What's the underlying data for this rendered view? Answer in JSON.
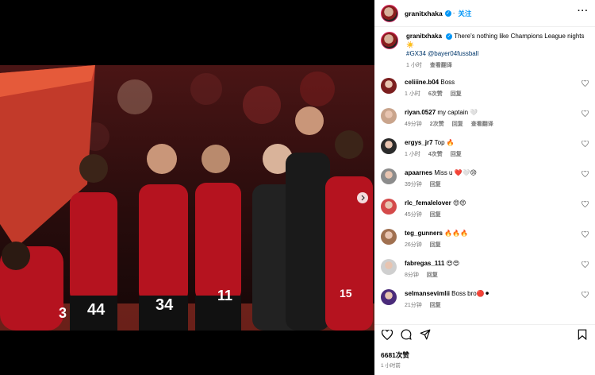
{
  "post": {
    "author": "granitxhaka",
    "follow_label": "关注",
    "more_label": "···"
  },
  "caption": {
    "username": "granitxhaka",
    "text": "There's nothing like Champions League nights ☀️",
    "hashtags": "#GX34 @bayer04fussball",
    "time": "1 小时",
    "translate": "查看翻译"
  },
  "comments": [
    {
      "username": "celiiine.b04",
      "text": "Boss",
      "time": "1 小时",
      "likes": "6次赞",
      "reply": "回复",
      "translate": ""
    },
    {
      "username": "riyan.0527",
      "text": "my captain 🤍",
      "time": "49分钟",
      "likes": "2次赞",
      "reply": "回复",
      "translate": "查看翻译"
    },
    {
      "username": "ergys_jr7",
      "text": "Top 🔥",
      "time": "1 小时",
      "likes": "4次赞",
      "reply": "回复",
      "translate": ""
    },
    {
      "username": "apaarnes",
      "text": "Miss u ❤️🤍😢",
      "time": "39分钟",
      "likes": "",
      "reply": "回复",
      "translate": ""
    },
    {
      "username": "rlc_femalelover",
      "text": "😍😍",
      "time": "45分钟",
      "likes": "",
      "reply": "回复",
      "translate": ""
    },
    {
      "username": "teg_gunners",
      "text": "🔥🔥🔥",
      "time": "26分钟",
      "likes": "",
      "reply": "回复",
      "translate": ""
    },
    {
      "username": "fabregas_111",
      "text": "😍😍",
      "time": "8分钟",
      "likes": "",
      "reply": "回复",
      "translate": ""
    },
    {
      "username": "selmansevimlii",
      "text": "Boss bro🔴⚫",
      "time": "21分钟",
      "likes": "",
      "reply": "回复",
      "translate": ""
    }
  ],
  "footer": {
    "likes": "6681次赞",
    "time": "1 小时前"
  },
  "photo_jerseys": [
    "44",
    "34",
    "11",
    "15",
    "3"
  ]
}
